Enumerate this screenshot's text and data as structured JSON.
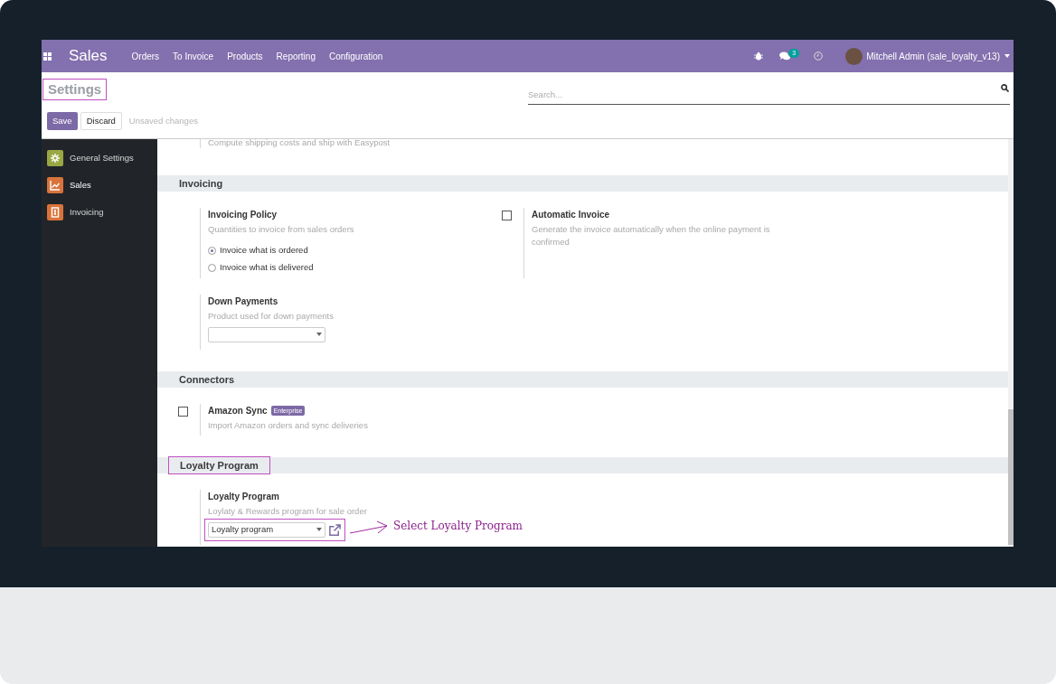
{
  "navbar": {
    "app": "Sales",
    "menu": [
      "Orders",
      "To Invoice",
      "Products",
      "Reporting",
      "Configuration"
    ],
    "message_count": "3",
    "user": "Mitchell Admin (sale_loyalty_v13)"
  },
  "control_panel": {
    "title": "Settings",
    "title_highlighted": true,
    "search": {
      "placeholder": "Search..."
    },
    "buttons": [
      {
        "label": "Save",
        "kind": "primary"
      },
      {
        "label": "Discard",
        "kind": "secondary"
      }
    ],
    "status": "Unsaved changes"
  },
  "sidebar": {
    "items": [
      {
        "label": "General Settings",
        "selected": false,
        "color": "#9aa843"
      },
      {
        "label": "Sales",
        "selected": true,
        "color": "#d9733b"
      },
      {
        "label": "Invoicing",
        "selected": false,
        "color": "#d9733b"
      }
    ]
  },
  "cut_text": "Compute shipping costs and ship with Easypost",
  "sections": [
    {
      "title": "Invoicing",
      "settings": [
        {
          "title": "Invoicing Policy",
          "description": "Quantities to invoice from sales orders",
          "radios": [
            {
              "label": "Invoice what is ordered",
              "selected": true
            },
            {
              "label": "Invoice what is delivered",
              "selected": false
            }
          ]
        },
        {
          "title": "Automatic Invoice",
          "description": "Generate the invoice automatically when the online payment is confirmed",
          "checkbox": {
            "checked": false
          }
        },
        {
          "title": "Down Payments",
          "description": "Product used for down payments",
          "select": {
            "kind": "dropdown"
          }
        }
      ]
    },
    {
      "title": "Connectors",
      "settings": [
        {
          "title": "Amazon Sync",
          "badge": "Enterprise",
          "description": "Import Amazon orders and sync deliveries",
          "checkbox": {
            "checked": false
          }
        }
      ]
    },
    {
      "title": "Loyalty Program",
      "highlighted": true,
      "settings": [
        {
          "title": "Loyalty Program",
          "description": "Loylaty & Rewards program for sale order",
          "select": {
            "kind": "dropdown",
            "value": "Loyalty program",
            "highlighted": true,
            "link": true
          },
          "annotation": "Select Loyalty Program"
        }
      ]
    }
  ]
}
